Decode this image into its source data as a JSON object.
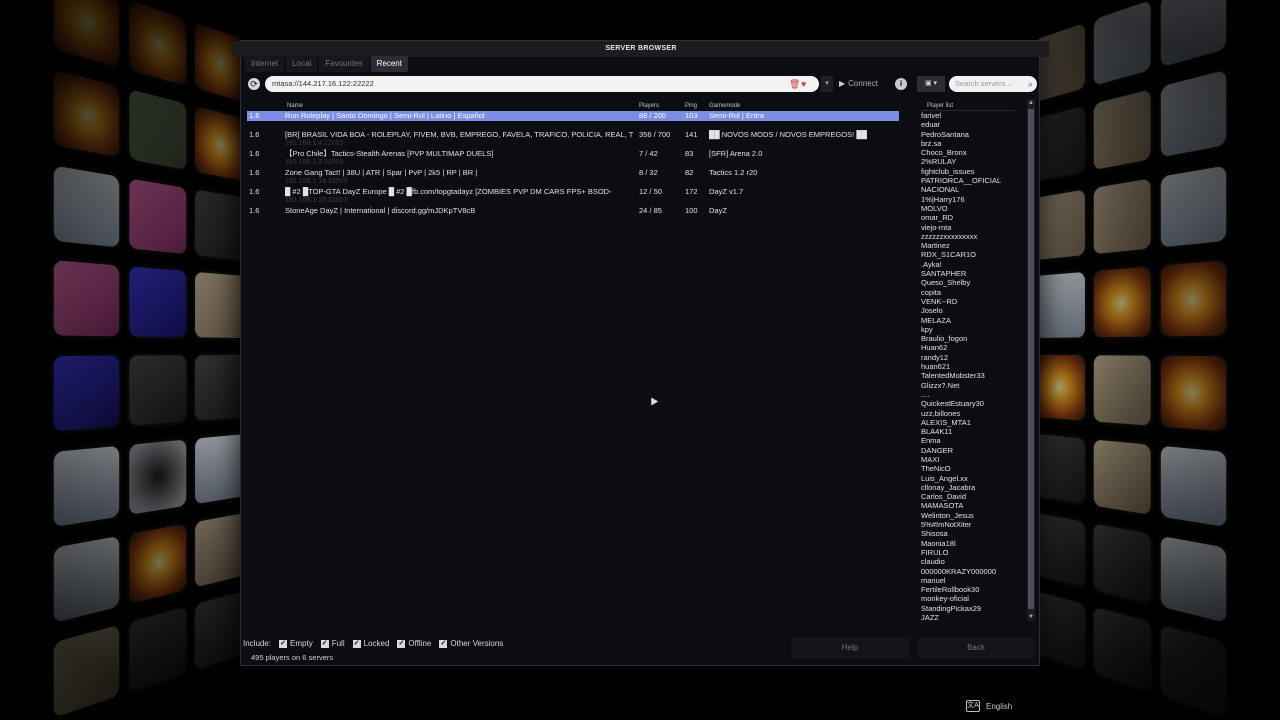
{
  "window": {
    "title": "SERVER BROWSER"
  },
  "tabs": [
    {
      "label": "Internet",
      "active": false
    },
    {
      "label": "Local",
      "active": false
    },
    {
      "label": "Favourites",
      "active": false
    },
    {
      "label": "Recent",
      "active": true
    }
  ],
  "toolbar": {
    "address": "mtasa://144.217.16.122:22222",
    "connect_label": "Connect",
    "search_placeholder": "Search servers..."
  },
  "columns": {
    "name": "Name",
    "players": "Players",
    "ping": "Ping",
    "gamemode": "Gamemode"
  },
  "servers": [
    {
      "version": "1.6",
      "name": "Run Roleplay | Santo Domingo | Semi-Rol | Latino | Español",
      "players": "88 / 200",
      "ping": "103",
      "gamemode": "Semi-Rol | Entra",
      "ip": "",
      "selected": true
    },
    {
      "version": "1.6",
      "name": "[BR] BRASIL VIDA BOA - ROLEPLAY, FIVEM, BVB, EMPREGO, FAVELA, TRAFICO, POLICIA, REAL, T",
      "players": "356 / 700",
      "ping": "141",
      "gamemode": "██ NOVOS MODS / NOVOS EMPREGOS! ██",
      "ip": "192.168.1.4:22003",
      "selected": false
    },
    {
      "version": "1.6",
      "name": "【Pro Chile】Tactics-Stealth Arenas [PVP MULTIMAP DUELS]",
      "players": "7 / 42",
      "ping": "83",
      "gamemode": "[SFR] Arena 2.0",
      "ip": "192.168.1.3:22003",
      "selected": false
    },
    {
      "version": "1.6",
      "name": "Zone Gang Tact! | 38U | ATR | Spar | PvP | 2k5 | RP | BR |",
      "players": "8 / 32",
      "ping": "82",
      "gamemode": "Tactics 1.2 r20",
      "ip": "192.168.1.18:22003",
      "selected": false
    },
    {
      "version": "1.6",
      "name": "█ #2 █TOP-GTA DayZ Europe █ #2 █fb.com/topgtadayz [ZOMBIES PVP DM CARS FPS+ BSOD-",
      "players": "12 / 50",
      "ping": "172",
      "gamemode": "DayZ v1.7",
      "ip": "192.168.1.10:22003",
      "selected": false
    },
    {
      "version": "1.6",
      "name": "StoneAge DayZ | International | discord.gg/mJDKpTV8cB",
      "players": "24 / 85",
      "ping": "100",
      "gamemode": "DayZ",
      "ip": "",
      "selected": false
    }
  ],
  "player_list": {
    "header": "Player list",
    "players": [
      "farivel",
      "eduar",
      "PedroSantana",
      "brz.sa",
      "Choco_Bronx",
      "2%RULAY",
      "fightclub_issues",
      "PATRIORCA__OFICIAL",
      "NACIONAL",
      "1%|Harry176",
      "MOLVO",
      "omar_RD",
      "viejo-mta",
      "zzzzzzxxxxxxxxx",
      "Martinez",
      "RDX_S1CAR1O",
      ".Ayka!",
      "SANTAPHER",
      "Queso_Shelby",
      "copita",
      "VENK--RD",
      "Joselo",
      "MELAZA",
      "kpy",
      "Braulio_fogon",
      "Huan62",
      "randy12",
      "huan621",
      "TalentedMobster33",
      "Glizzx?.Net",
      "....",
      "QuickestEstuary30",
      "uzz,billones",
      "ALEXIS_MTA1",
      "BLA4K11",
      "Enma",
      "DANGER",
      "MAXI",
      "TheNicO",
      "Luis_Angel.xx",
      "cllonay_Jacabra",
      "Carlos_David",
      "MAMASOTA",
      "Welinton_Jesus",
      "5%#ImNotXiter",
      "Shisosa",
      "Maonia18l",
      "FIRULO",
      "claudio",
      "000000KRAZY000000",
      "manuel",
      "FertileRollbook30",
      "monkey-oficial",
      "StandingPickax29",
      "JAZZ"
    ]
  },
  "footer": {
    "include_label": "Include:",
    "filters": [
      "Empty",
      "Full",
      "Locked",
      "Offline",
      "Other Versions"
    ],
    "status": "495 players on 6 servers",
    "help_label": "Help",
    "back_label": "Back"
  },
  "language": {
    "label": "English"
  }
}
